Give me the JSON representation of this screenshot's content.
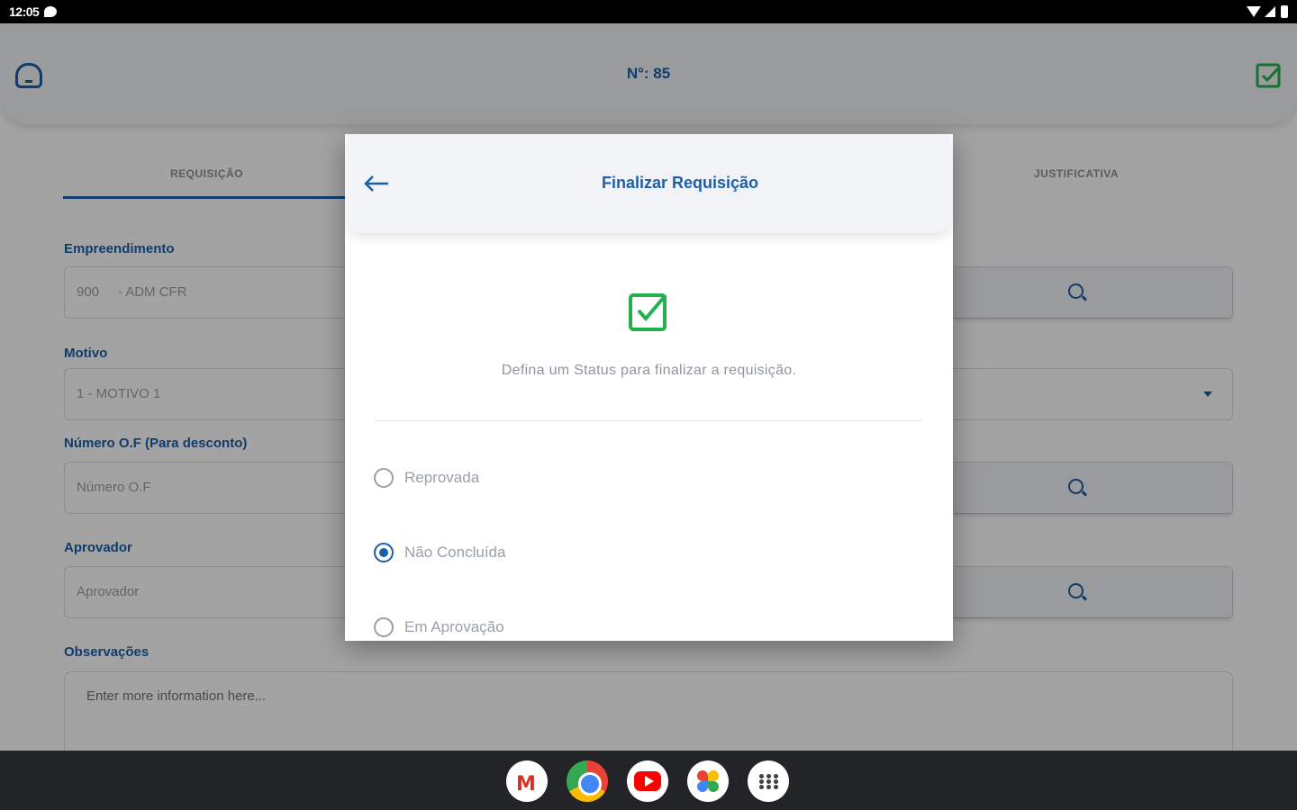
{
  "status_bar": {
    "time": "12:05"
  },
  "header": {
    "title": "N°: 85"
  },
  "tabs": {
    "requisicao": "REQUISIÇÃO",
    "justificativa": "JUSTIFICATIVA"
  },
  "form": {
    "empreendimento": {
      "label": "Empreendimento",
      "value": "900     - ADM CFR"
    },
    "motivo": {
      "label": "Motivo",
      "value": "1 - MOTIVO 1"
    },
    "numero_of": {
      "label": "Número O.F (Para desconto)",
      "placeholder": "Número O.F"
    },
    "aprovador": {
      "label": "Aprovador",
      "placeholder": "Aprovador"
    },
    "observacoes": {
      "label": "Observações",
      "placeholder": "Enter more information here..."
    }
  },
  "dialog": {
    "title": "Finalizar Requisição",
    "description": "Defina um Status para finalizar a requisição.",
    "options": [
      {
        "label": "Reprovada",
        "selected": false
      },
      {
        "label": "Não Concluída",
        "selected": true
      },
      {
        "label": "Em Aprovação",
        "selected": false
      }
    ]
  },
  "colors": {
    "primary": "#1a5fa8",
    "success": "#22b14c",
    "scrim": "#000000"
  },
  "dock": [
    "gmail-icon",
    "chrome-icon",
    "youtube-icon",
    "photos-icon",
    "apps-icon"
  ]
}
